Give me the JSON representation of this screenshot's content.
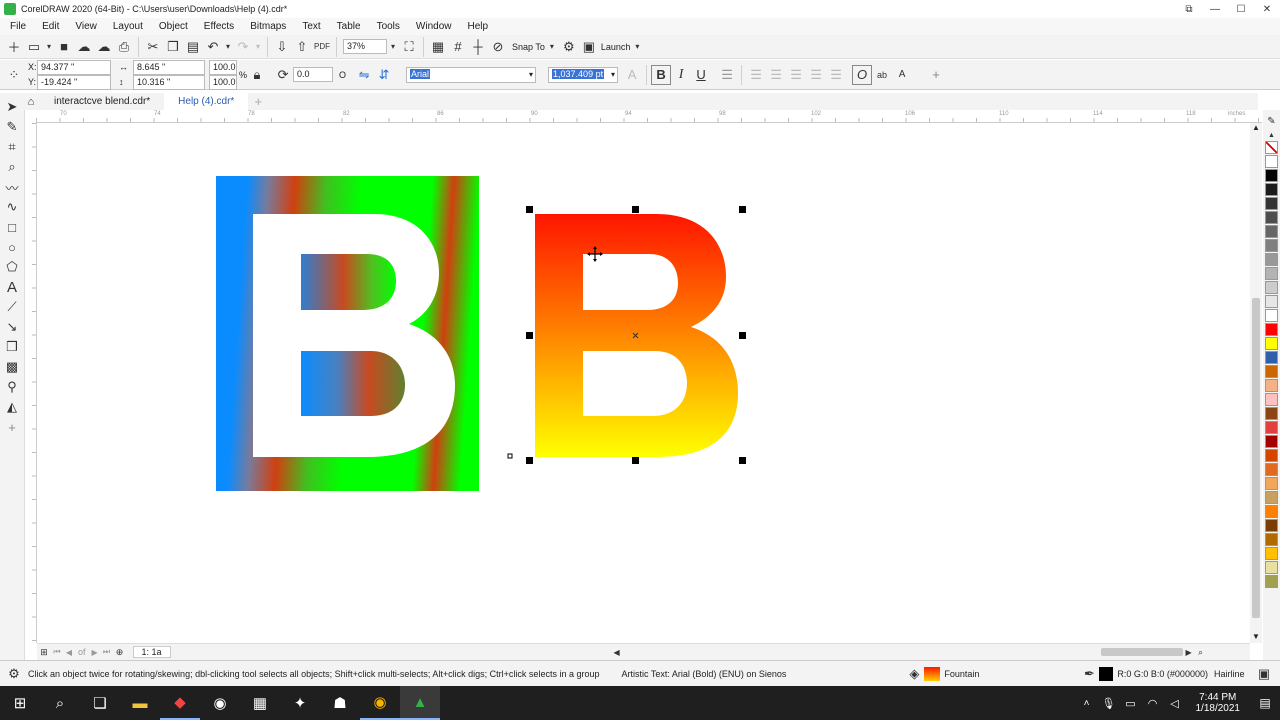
{
  "window": {
    "title": "CorelDRAW 2020 (64-Bit) - C:\\Users\\user\\Downloads\\Help (4).cdr*",
    "controls": [
      "⧉",
      "—",
      "☐",
      "✕"
    ]
  },
  "menu": [
    "File",
    "Edit",
    "View",
    "Layout",
    "Object",
    "Effects",
    "Bitmaps",
    "Text",
    "Table",
    "Tools",
    "Window",
    "Help"
  ],
  "toolbar1": {
    "zoom": "37%",
    "snap_to": "Snap To",
    "launch": "Launch"
  },
  "property_bar": {
    "x": "94.377 \"",
    "y": "-19.424 \"",
    "width": "8.645 \"",
    "height": "10.316 \"",
    "scale_x": "100.0",
    "scale_y": "100.0",
    "scale_unit": "%",
    "rotation": "0.0",
    "rotation_unit": "O",
    "font": "Arial",
    "font_size": "1,037.409 pt",
    "bold": "B",
    "italic": "I",
    "underline": "U"
  },
  "tabs": [
    {
      "label": "interactcve blend.cdr*"
    },
    {
      "label": "Help (4).cdr*"
    }
  ],
  "ruler": {
    "unit": "inches",
    "marks": [
      "70",
      "74",
      "78",
      "82",
      "86",
      "90",
      "94",
      "98",
      "102",
      "106",
      "110",
      "114",
      "118"
    ]
  },
  "canvas": {
    "letter_left": "B",
    "letter_right": "B"
  },
  "pagebar": {
    "page": "1: 1a",
    "of_label": "of"
  },
  "status": {
    "hint": "Click an object twice for rotating/skewing; dbl-clicking tool selects all objects; Shift+click multi-selects; Alt+click digs; Ctrl+click selects in a group",
    "object_info": "Artistic Text: Arial (Bold) (ENU) on Sienos",
    "fill_type": "Fountain",
    "outline_color": "R:0 G:0 B:0 (#000000)",
    "outline_width": "Hairline"
  },
  "palette_colors": [
    "#ffffff",
    "#000000",
    "#1a1a1a",
    "#333333",
    "#4d4d4d",
    "#666666",
    "#808080",
    "#999999",
    "#b3b3b3",
    "#cccccc",
    "#e6e6e6",
    "#ffffff",
    "#ff0000",
    "#ffff00",
    "#2e5fa8",
    "#cc6600",
    "#f4b183",
    "#ffc0c0",
    "#8b4513",
    "#e04040",
    "#a00000",
    "#d24600",
    "#e06a20",
    "#f2a65a",
    "#c8a060",
    "#ff7f00",
    "#7a3e00",
    "#b06a00",
    "#ffc000",
    "#e8e0a0",
    "#a0a050"
  ],
  "taskbar": {
    "time": "7:44 PM",
    "date": "1/18/2021"
  },
  "colors": {
    "accent": "#0a74da",
    "selection_blue": "#3a73d6"
  }
}
